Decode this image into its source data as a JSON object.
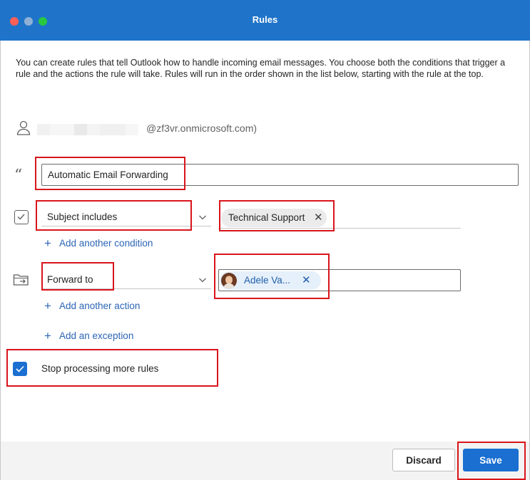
{
  "window": {
    "title": "Rules"
  },
  "intro_text": "You can create rules that tell Outlook how to handle incoming email messages. You choose both the conditions that trigger a rule and the actions the rule will take. Rules will run in the order shown in the list below, starting with the rule at the top.",
  "account": {
    "email_suffix": "@zf3vr.onmicrosoft.com)",
    "icon": "person-icon"
  },
  "rule_name": {
    "icon": "quote-icon",
    "value": "Automatic Email Forwarding"
  },
  "condition": {
    "icon": "checkbox-outline-icon",
    "selected": "Subject includes",
    "value_chip": "Technical Support",
    "add_label": "Add another condition"
  },
  "action": {
    "icon": "folder-move-icon",
    "selected": "Forward to",
    "recipient": "Adele Va...",
    "add_label": "Add another action"
  },
  "exception": {
    "add_label": "Add an exception"
  },
  "stop_processing": {
    "label": "Stop processing more rules",
    "checked": true
  },
  "footer": {
    "discard_label": "Discard",
    "save_label": "Save"
  },
  "colors": {
    "accent": "#1a6fd1",
    "titlebar": "#1f74c9",
    "link": "#2b64b5",
    "highlight_box": "#d9141b"
  }
}
